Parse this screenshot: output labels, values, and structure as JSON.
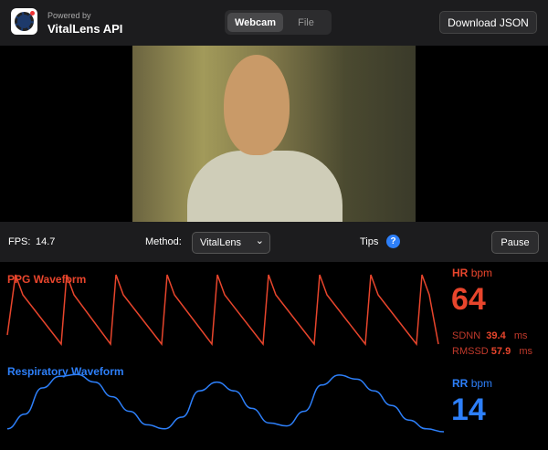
{
  "header": {
    "powered_by": "Powered by",
    "app_name": "VitalLens API",
    "tabs": [
      "Webcam",
      "File"
    ],
    "download_label": "Download JSON"
  },
  "controls": {
    "fps_label": "FPS:",
    "fps_value": "14.7",
    "method_label": "Method:",
    "method_value": "VitalLens",
    "tips_label": "Tips",
    "tips_icon": "?",
    "pause_label": "Pause"
  },
  "ppg": {
    "title": "PPG Waveform",
    "color": "#e8452c",
    "hr_label": "HR",
    "hr_unit": "bpm",
    "hr_value": "64",
    "sdnn_label": "SDNN",
    "sdnn_value": "39.4",
    "sdnn_unit": "ms",
    "rmssd_label": "RMSSD",
    "rmssd_value": "57.9",
    "rmssd_unit": "ms",
    "peaks_x": [
      17,
      73,
      127,
      183,
      238,
      294,
      350,
      406,
      462
    ]
  },
  "resp": {
    "title": "Respiratory Waveform",
    "color": "#2d7ff9",
    "rr_label": "RR",
    "rr_unit": "bpm",
    "rr_value": "14",
    "samples": [
      0.05,
      0.3,
      0.75,
      0.95,
      0.98,
      0.85,
      0.6,
      0.35,
      0.12,
      0.05,
      0.25,
      0.7,
      0.85,
      0.7,
      0.4,
      0.15,
      0.1,
      0.35,
      0.8,
      0.97,
      0.9,
      0.7,
      0.45,
      0.2,
      0.05,
      0.0
    ]
  }
}
